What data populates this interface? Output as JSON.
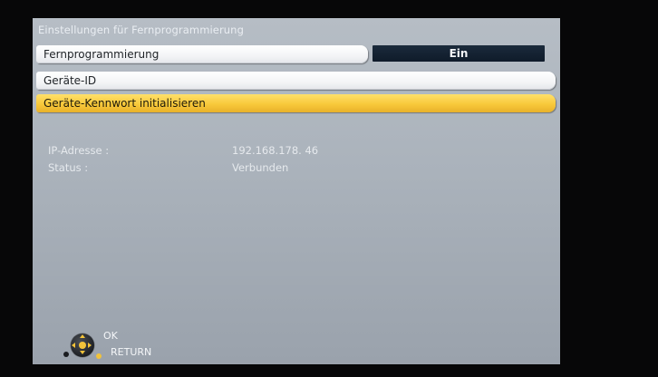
{
  "menu": {
    "title": "Einstellungen für Fernprogrammierung",
    "items": [
      {
        "label": "Fernprogrammierung",
        "value": "Ein"
      },
      {
        "label": "Geräte-ID"
      },
      {
        "label": "Geräte-Kennwort initialisieren"
      }
    ]
  },
  "info": {
    "ip_label": "IP-Adresse :",
    "ip_value": "192.168.178. 46",
    "status_label": "Status :",
    "status_value": "Verbunden"
  },
  "hints": {
    "ok_label": "OK",
    "return_label": "RETURN",
    "icons": [
      "navigation-pad-icon",
      "return-button-icon"
    ]
  },
  "colors": {
    "highlight": "#f8c93b",
    "value_box": "#13202f",
    "screen_bg": "#aab2bb"
  }
}
